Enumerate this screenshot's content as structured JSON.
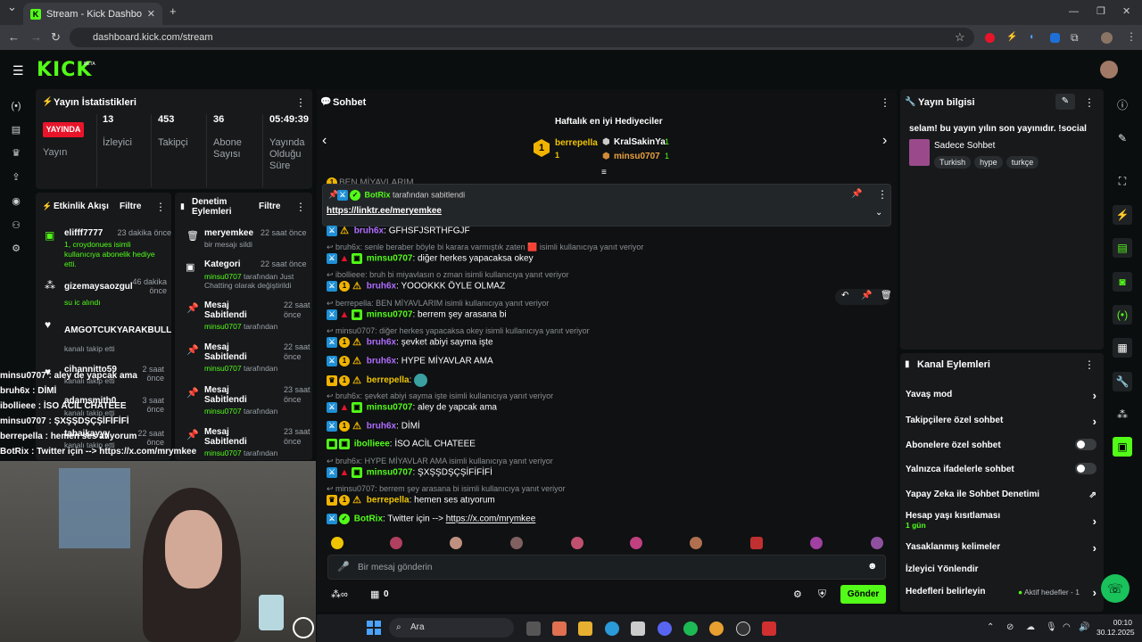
{
  "browser": {
    "tab_title": "Stream - Kick Dashboard",
    "url": "dashboard.kick.com/stream"
  },
  "app": {
    "logo": "KICK",
    "beta": "BETA"
  },
  "stats": {
    "title": "Yayın İstatistikleri",
    "live_badge": "YAYINDA",
    "broadcast_label": "Yayın",
    "viewers_value": "13",
    "viewers_label": "İzleyici",
    "followers_value": "453",
    "followers_label": "Takipçi",
    "subs_value": "36",
    "subs_label": "Abone Sayısı",
    "uptime_value": "05:49:39",
    "uptime_label": "Yayında Olduğu Süre"
  },
  "activity": {
    "title": "Etkinlik Akışı",
    "filter": "Filtre",
    "items": [
      {
        "name": "elifff7777",
        "time": "23 dakika önce",
        "desc": "1, croydonues isimli kullanıcıya abonelik hediye etti."
      },
      {
        "name": "gizemaysaozgul",
        "time": "46 dakika önce",
        "desc": "su ic alındı"
      },
      {
        "name": "AMGOTCUKYARAKBULL",
        "time": "",
        "desc": "kanalı takip etti"
      },
      {
        "name": "cihannitto59",
        "time": "2 saat önce",
        "desc": "kanalı takip etti"
      },
      {
        "name": "adamsmith0",
        "time": "3 saat önce",
        "desc": "kanalı takip etti"
      },
      {
        "name": "tahaikayyy",
        "time": "22 saat önce",
        "desc": "kanalı takip etti"
      }
    ]
  },
  "moderation": {
    "title": "Denetim Eylemleri",
    "filter": "Filtre",
    "items": [
      {
        "name": "meryemkee",
        "time": "22 saat önce",
        "desc": "bir mesajı sildi"
      },
      {
        "name": "Kategori",
        "time": "22 saat önce",
        "desc_user": "minsu0707",
        "desc": "tarafından Just Chatting olarak değiştirildi"
      },
      {
        "name": "Mesaj Sabitlendi",
        "time": "22 saat önce",
        "desc_user": "minsu0707",
        "desc": "tarafından"
      },
      {
        "name": "Mesaj Sabitlendi",
        "time": "22 saat önce",
        "desc_user": "minsu0707",
        "desc": "tarafından"
      },
      {
        "name": "Mesaj Sabitlendi",
        "time": "23 saat önce",
        "desc_user": "minsu0707",
        "desc": "tarafından"
      },
      {
        "name": "Mesaj Sabitlendi",
        "time": "23 saat önce",
        "desc_user": "minsu0707",
        "desc": "tarafından"
      }
    ]
  },
  "chat": {
    "title": "Sohbet",
    "gifters_title": "Haftalık en iyi Hediyeciler",
    "gifter1_name": "berrepella",
    "gifter1_count": "1",
    "gifter2_name": "KralSakinYa",
    "gifter2_count": "1",
    "gifter3_name": "minsu0707",
    "gifter3_count": "1",
    "pinned_by": "BotRix",
    "pinned_suffix": "tarafından sabitlendi",
    "pinned_link": "https://linktr.ee/meryemkee",
    "partial_top": "BEN MİYAVLARIM",
    "messages": [
      {
        "user": "bruh6x",
        "text": "GFHSFJSRTHFGJF",
        "color": "purple"
      },
      {
        "reply": "bruh6x: senle beraber böyle bi karara varmıştık zaten 🟥 isimli kullanıcıya yanıt veriyor"
      },
      {
        "user": "minsu0707",
        "text": "diğer herkes yapacaksa okey",
        "color": "green"
      },
      {
        "reply": "ibollieee: bruh bi miyavlasın o zman isimli kullanıcıya yanıt veriyor"
      },
      {
        "user": "bruh6x",
        "text": "YOOOKKK ÖYLE OLMAZ",
        "color": "purple"
      },
      {
        "reply": "berrepella: BEN MİYAVLARIM isimli kullanıcıya yanıt veriyor"
      },
      {
        "user": "minsu0707",
        "text": "berrem şey arasana bi",
        "color": "green"
      },
      {
        "reply": "minsu0707: diğer herkes yapacaksa okey isimli kullanıcıya yanıt veriyor"
      },
      {
        "user": "bruh6x",
        "text": "şevket abiyi sayma işte",
        "color": "purple"
      },
      {
        "user": "bruh6x",
        "text": "HYPE MİYAVLAR AMA",
        "color": "purple"
      },
      {
        "user": "berrepella",
        "text": "",
        "color": "gold"
      },
      {
        "reply": "bruh6x: şevket abiyi sayma işte isimli kullanıcıya yanıt veriyor"
      },
      {
        "user": "minsu0707",
        "text": "aley de yapcak ama",
        "color": "green"
      },
      {
        "user": "bruh6x",
        "text": "DİMİ",
        "color": "purple"
      },
      {
        "user": "ibollieee",
        "text": "İSO ACİL CHATEEE",
        "color": "green"
      },
      {
        "reply": "bruh6x: HYPE MİYAVLAR AMA isimli kullanıcıya yanıt veriyor"
      },
      {
        "user": "minsu0707",
        "text": "ŞXŞŞDŞÇŞİFİFİFİ",
        "color": "green"
      },
      {
        "reply": "minsu0707: berrem şey arasana bi isimli kullanıcıya yanıt veriyor"
      },
      {
        "user": "berrepella",
        "text": "hemen ses atıyorum",
        "color": "gold"
      },
      {
        "user": "BotRix",
        "text": "Twitter için --> ",
        "link": "https://x.com/mrymkee",
        "color": "green"
      }
    ],
    "input_placeholder": "Bir mesaj gönderin",
    "points": "0",
    "send": "Gönder"
  },
  "stream_info": {
    "title": "Yayın bilgisi",
    "stream_title": "selam! bu yayın yılın son yayınıdır. !social",
    "category": "Sadece Sohbet",
    "tags": [
      "Turkish",
      "hype",
      "turkçe"
    ]
  },
  "channel_actions": {
    "title": "Kanal Eylemleri",
    "slow_mode": "Yavaş mod",
    "followers_only": "Takipçilere özel sohbet",
    "subs_only": "Abonelere özel sohbet",
    "emotes_only": "Yalnızca ifadelerle sohbet",
    "ai_mod": "Yapay Zeka ile Sohbet Denetimi",
    "age_limit": "Hesap yaşı kısıtlaması",
    "age_limit_value": "1 gün",
    "banned_words": "Yasaklanmış kelimeler",
    "viewer_redirect": "İzleyici Yönlendir",
    "goals": "Hedefleri belirleyin",
    "goals_status": "Aktif hedefler - 1"
  },
  "overlay_chat": [
    "minsu0707 : aley de yapcak ama",
    "bruh6x : DİMİ",
    "ibollieee : İSO ACİL CHATEEE",
    "minsu0707 : ŞXŞŞDŞÇŞİFİFİFİ",
    "berrepella : hemen ses atıyorum",
    "BotRix : Twitter için --> https://x.com/mrymkee"
  ],
  "taskbar": {
    "search": "Ara",
    "time": "00:10",
    "date": "30.12.2025"
  },
  "colors": {
    "kick_green": "#53fc18",
    "live_red": "#e8142a",
    "panel_bg": "#17191b"
  }
}
